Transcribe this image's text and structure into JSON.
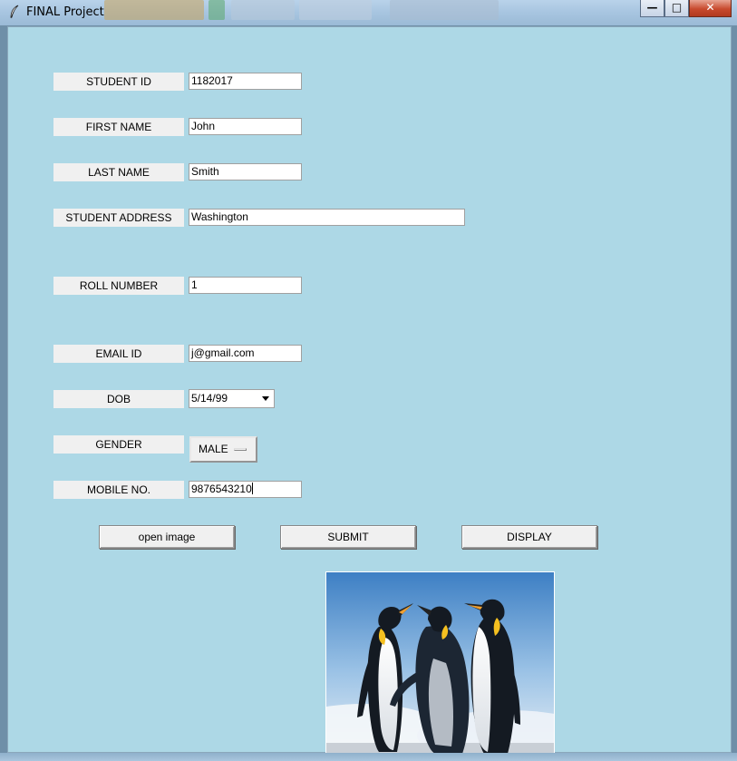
{
  "window": {
    "title": "FINAL Project",
    "controls": {
      "minimize_glyph": "—",
      "maximize_glyph": "□",
      "close_glyph": "✕"
    }
  },
  "labels": {
    "student_id": "STUDENT ID",
    "first_name": "FIRST NAME",
    "last_name": "LAST NAME",
    "student_address": "STUDENT ADDRESS",
    "roll_number": "ROLL NUMBER",
    "email_id": "EMAIL ID",
    "dob": "DOB",
    "gender": "GENDER",
    "mobile_no": "MOBILE NO."
  },
  "fields": {
    "student_id": "1182017",
    "first_name": "John",
    "last_name": "Smith",
    "student_address": "Washington",
    "roll_number": "1",
    "email_id": "j@gmail.com",
    "dob": "5/14/99",
    "gender": "MALE",
    "mobile_no": "9876543210"
  },
  "buttons": {
    "open_image": "open image",
    "submit": "SUBMIT",
    "display": "DISPLAY"
  },
  "colors": {
    "client_background": "#add8e6",
    "label_background": "#f0f0f0",
    "close_button": "#c84a2e"
  },
  "image": {
    "subject": "penguins"
  }
}
